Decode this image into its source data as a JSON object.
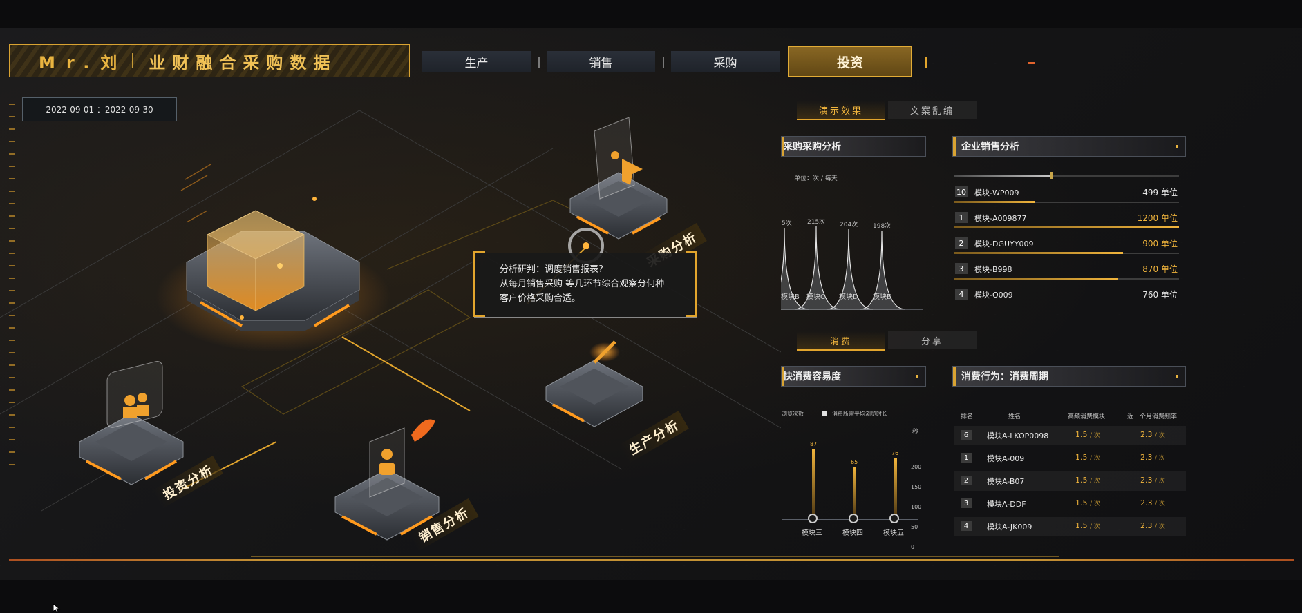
{
  "header": {
    "user": "Mr.刘",
    "title": "业财融合采购数据",
    "nav": [
      {
        "label": "生产"
      },
      {
        "label": "销售"
      },
      {
        "label": "采购"
      },
      {
        "label": "投资",
        "active": true
      }
    ]
  },
  "date_range": "2022-09-01 ：2022-09-30",
  "scene": {
    "nodes": [
      {
        "label": "采购分析"
      },
      {
        "label": "生产分析"
      },
      {
        "label": "销售分析"
      },
      {
        "label": "投资分析"
      }
    ],
    "callout": {
      "line1": "分析研判：调度销售报表?",
      "line2": "从每月销售采购 等几环节综合观察分何种",
      "line3": "客户价格采购合适。"
    }
  },
  "upper_tabs": [
    {
      "label": "演示效果"
    },
    {
      "label": "文案乱编"
    }
  ],
  "lower_tabs": [
    {
      "label": "消费"
    },
    {
      "label": "分享"
    }
  ],
  "purchase_panel": {
    "title": "采购采购分析",
    "unit": "单位：次 / 每天",
    "peak_labels": [
      "5次",
      "215次",
      "204次",
      "198次"
    ],
    "x_labels": [
      "模块B",
      "模块C",
      "模块D",
      "模块E"
    ]
  },
  "sales_panel": {
    "title": "企业销售分析",
    "rows": [
      {
        "rank": "10",
        "name": "模块-WP009",
        "value": "499 单位",
        "level": 0.36,
        "gold": false
      },
      {
        "rank": "1",
        "name": "模块-A009877",
        "value": "1200 单位",
        "level": 1.0,
        "gold": true
      },
      {
        "rank": "2",
        "name": "模块-DGUYY009",
        "value": "900 单位",
        "level": 0.75,
        "gold": true
      },
      {
        "rank": "3",
        "name": "模块-B998",
        "value": "870 单位",
        "level": 0.73,
        "gold": true
      },
      {
        "rank": "4",
        "name": "模块-O009",
        "value": "760 单位",
        "level": 0.0,
        "gold": false
      }
    ]
  },
  "ease_panel": {
    "title": "快消费容易度",
    "legend": [
      "浏览次数",
      "消费所需平均浏览时长"
    ],
    "axis_unit": "秒",
    "y_ticks": [
      "200",
      "150",
      "100",
      "50",
      "0"
    ],
    "bars": [
      {
        "label": "模块三",
        "value": "87"
      },
      {
        "label": "模块四",
        "value": "65"
      },
      {
        "label": "模块五",
        "value": "76"
      }
    ]
  },
  "cycle_panel": {
    "title": "消费行为：消费周期",
    "headers": [
      "排名",
      "姓名",
      "高频消费模块",
      "近一个月消费频率"
    ],
    "rows": [
      {
        "rank": "6",
        "name": "模块A-LKOP0098",
        "freq": "1.5",
        "monthly": "2.3"
      },
      {
        "rank": "1",
        "name": "模块A-009",
        "freq": "1.5",
        "monthly": "2.3"
      },
      {
        "rank": "2",
        "name": "模块A-B07",
        "freq": "1.5",
        "monthly": "2.3"
      },
      {
        "rank": "3",
        "name": "模块A-DDF",
        "freq": "1.5",
        "monthly": "2.3"
      },
      {
        "rank": "4",
        "name": "模块A-JK009",
        "freq": "1.5",
        "monthly": "2.3"
      }
    ],
    "unit": "/ 次"
  },
  "colors": {
    "accent": "#e2a52d",
    "text": "#e6e6e6",
    "background": "#151516"
  }
}
